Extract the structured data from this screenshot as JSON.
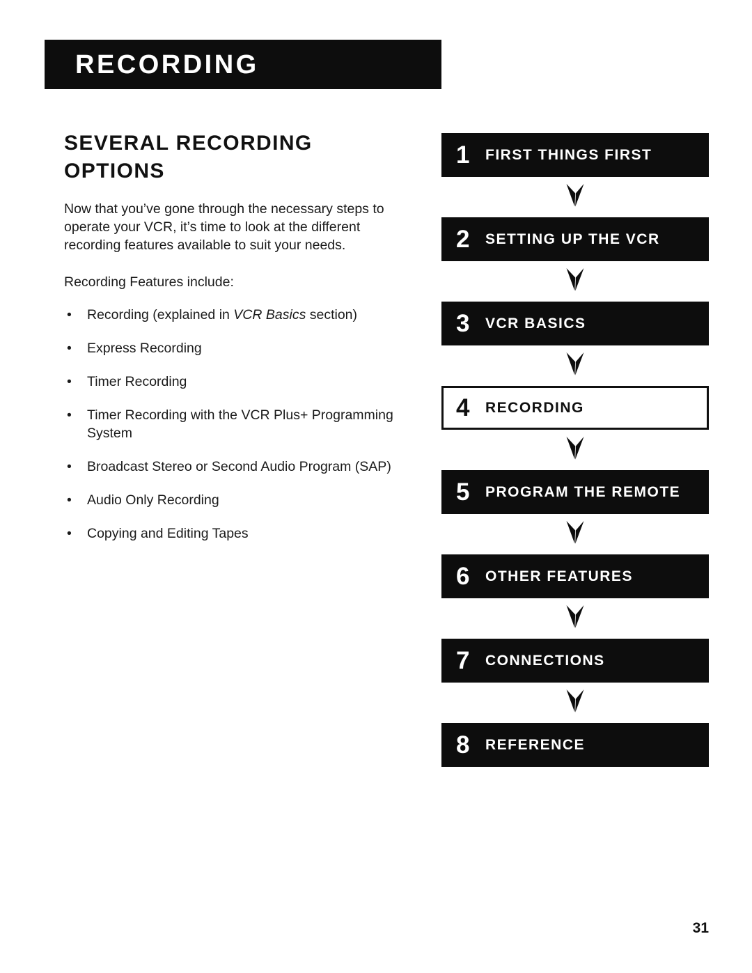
{
  "header": {
    "banner_title": "RECORDING"
  },
  "main": {
    "section_heading": "SEVERAL RECORDING OPTIONS",
    "intro_paragraph": "Now that you’ve gone through the necessary steps to operate your VCR, it’s time to look at the different recording features available to suit your needs.",
    "features_lead": "Recording Features include:",
    "features": [
      {
        "text_before": "Recording (explained in ",
        "emphasis": "VCR Basics",
        "text_after": " section)"
      },
      {
        "text_before": "Express Recording",
        "emphasis": "",
        "text_after": ""
      },
      {
        "text_before": "Timer Recording",
        "emphasis": "",
        "text_after": ""
      },
      {
        "text_before": "Timer Recording with the VCR Plus+ Programming System",
        "emphasis": "",
        "text_after": ""
      },
      {
        "text_before": "Broadcast Stereo or Second Audio Program (SAP)",
        "emphasis": "",
        "text_after": ""
      },
      {
        "text_before": "Audio Only Recording",
        "emphasis": "",
        "text_after": ""
      },
      {
        "text_before": "Copying and Editing Tapes",
        "emphasis": "",
        "text_after": ""
      }
    ],
    "bullet_glyph": "•"
  },
  "flowchart": {
    "steps": [
      {
        "number": "1",
        "label": "FIRST THINGS FIRST",
        "current": false
      },
      {
        "number": "2",
        "label": "SETTING UP THE VCR",
        "current": false
      },
      {
        "number": "3",
        "label": "VCR BASICS",
        "current": false
      },
      {
        "number": "4",
        "label": "RECORDING",
        "current": true
      },
      {
        "number": "5",
        "label": "PROGRAM THE REMOTE",
        "current": false
      },
      {
        "number": "6",
        "label": "OTHER FEATURES",
        "current": false
      },
      {
        "number": "7",
        "label": "CONNECTIONS",
        "current": false
      },
      {
        "number": "8",
        "label": "REFERENCE",
        "current": false
      }
    ],
    "arrow_icon": "chevron-down-arrow-icon"
  },
  "footer": {
    "page_number": "31"
  },
  "colors": {
    "ink": "#0d0d0d",
    "paper": "#ffffff",
    "text": "#1a1a1a"
  }
}
